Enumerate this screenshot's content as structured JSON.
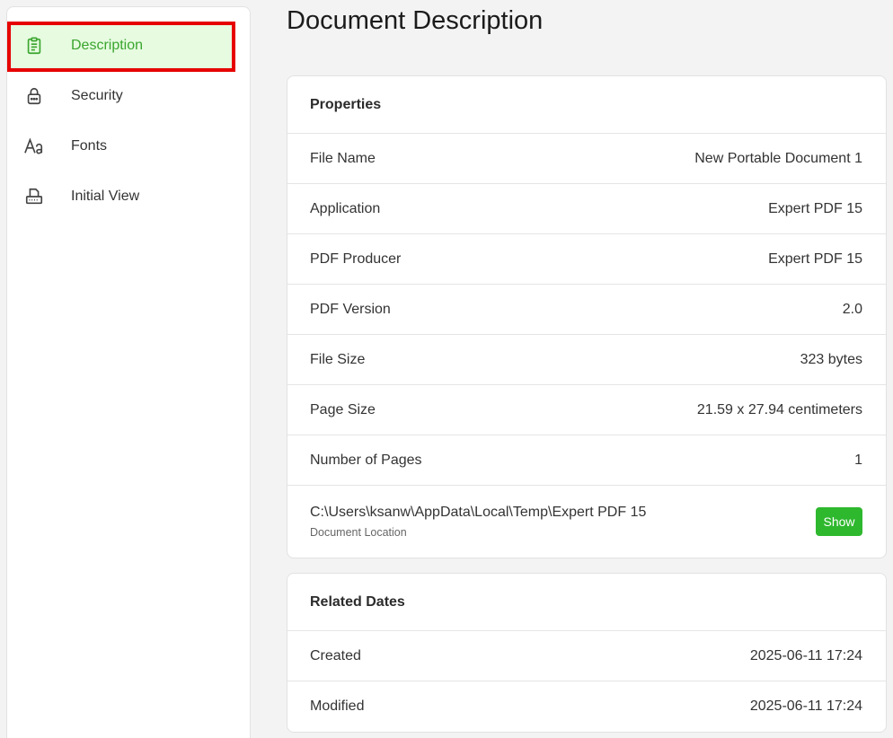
{
  "sidebar": {
    "items": [
      {
        "label": "Description",
        "icon": "clipboard-icon",
        "active": true
      },
      {
        "label": "Security",
        "icon": "lock-icon"
      },
      {
        "label": "Fonts",
        "icon": "font-icon"
      },
      {
        "label": "Initial View",
        "icon": "printer-icon"
      }
    ]
  },
  "page": {
    "title": "Document Description"
  },
  "properties": {
    "header": "Properties",
    "rows": [
      {
        "label": "File Name",
        "value": "New Portable Document 1"
      },
      {
        "label": "Application",
        "value": "Expert PDF 15"
      },
      {
        "label": "PDF Producer",
        "value": "Expert PDF 15"
      },
      {
        "label": "PDF Version",
        "value": "2.0"
      },
      {
        "label": "File Size",
        "value": "323 bytes"
      },
      {
        "label": "Page Size",
        "value": "21.59 x 27.94 centimeters"
      },
      {
        "label": "Number of Pages",
        "value": "1"
      }
    ],
    "location": {
      "path": "C:\\Users\\ksanw\\AppData\\Local\\Temp\\Expert PDF 15",
      "caption": "Document Location",
      "button": "Show"
    }
  },
  "dates": {
    "header": "Related Dates",
    "rows": [
      {
        "label": "Created",
        "value": "2025-06-11 17:24"
      },
      {
        "label": "Modified",
        "value": "2025-06-11 17:24"
      }
    ]
  },
  "colors": {
    "accent": "#3aa52e",
    "active_bg": "#e6fbe0",
    "highlight": "#e60000",
    "button": "#2eb82e"
  }
}
